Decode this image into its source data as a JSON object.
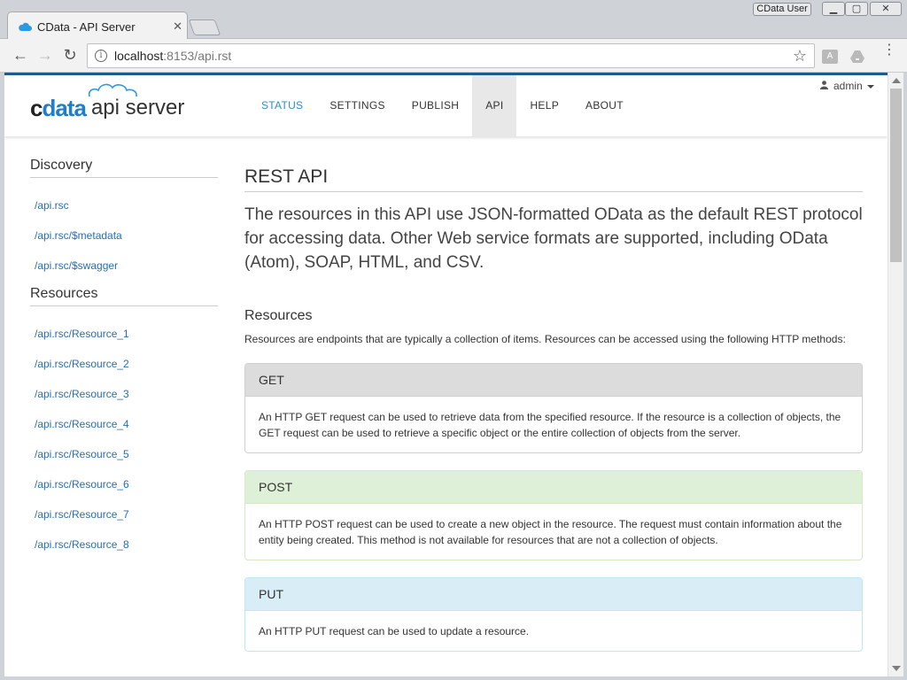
{
  "browser": {
    "tab_title": "CData - API Server",
    "tab_close": "✕",
    "profile": "CData User",
    "window_min": "▁",
    "window_max": "▢",
    "window_close": "✕",
    "url_host": "localhost",
    "url_rest": ":8153/api.rst",
    "pdf_label": "A"
  },
  "header": {
    "logo_c": "c",
    "logo_data": "data",
    "logo_api": "api server",
    "nav": [
      {
        "label": "STATUS"
      },
      {
        "label": "SETTINGS"
      },
      {
        "label": "PUBLISH"
      },
      {
        "label": "API"
      },
      {
        "label": "HELP"
      },
      {
        "label": "ABOUT"
      }
    ],
    "user": "admin"
  },
  "sidebar": {
    "discovery_heading": "Discovery",
    "discovery_links": [
      "/api.rsc",
      "/api.rsc/$metadata",
      "/api.rsc/$swagger"
    ],
    "resources_heading": "Resources",
    "resource_links": [
      "/api.rsc/Resource_1",
      "/api.rsc/Resource_2",
      "/api.rsc/Resource_3",
      "/api.rsc/Resource_4",
      "/api.rsc/Resource_5",
      "/api.rsc/Resource_6",
      "/api.rsc/Resource_7",
      "/api.rsc/Resource_8"
    ]
  },
  "main": {
    "title": "REST API",
    "lead": "The resources in this API use JSON-formatted OData as the default REST protocol for accessing data. Other Web service formats are supported, including OData (Atom), SOAP, HTML, and CSV.",
    "resources_title": "Resources",
    "resources_desc": "Resources are endpoints that are typically a collection of items. Resources can be accessed using the following HTTP methods:",
    "methods": [
      {
        "name": "GET",
        "desc": "An HTTP GET request can be used to retrieve data from the specified resource. If the resource is a collection of objects, the GET request can be used to retrieve a specific object or the entire collection of objects from the server."
      },
      {
        "name": "POST",
        "desc": "An HTTP POST request can be used to create a new object in the resource. The request must contain information about the entity being created. This method is not available for resources that are not a collection of objects."
      },
      {
        "name": "PUT",
        "desc": "An HTTP PUT request can be used to update a resource."
      }
    ]
  },
  "colors": {
    "accent_blue": "#2b8dc8",
    "link": "#2a6ea8",
    "header_border": "#1e5a8c",
    "get_header": "#dcdcdc",
    "post_header": "#dff0d8",
    "put_header": "#d9edf7"
  },
  "icons": {
    "favicon": "cloud-icon",
    "info": "info-icon",
    "star": "star-icon",
    "back": "back-arrow-icon",
    "forward": "forward-arrow-icon",
    "reload": "reload-icon",
    "user": "user-icon"
  }
}
